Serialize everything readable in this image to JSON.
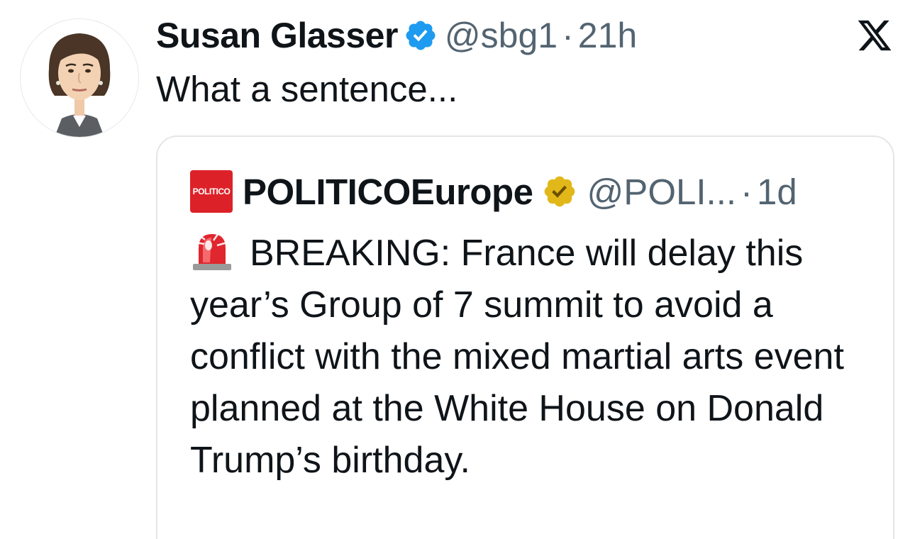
{
  "tweet": {
    "author_name": "Susan Glasser",
    "handle": "@sbg1",
    "separator": "·",
    "time": "21h",
    "text": "What a sentence...",
    "avatar_icon": "woman-cartoon-avatar",
    "verified_icon": "blue-check-badge",
    "platform_icon": "x-logo"
  },
  "quote": {
    "avatar_text": "POLITICO",
    "author_name": "POLITICOEurope",
    "handle": "@POLI...",
    "separator": "·",
    "time": "1d",
    "verified_icon": "gold-check-badge",
    "lead_icon": "police-siren-emoji",
    "text": "BREAKING: France will delay this year’s Group of 7 summit to avoid a conflict with the mixed martial arts event planned at the White House on Donald Trump’s birthday."
  },
  "colors": {
    "text": "#0f1419",
    "secondary": "#536471",
    "blue_badge": "#1d9bf0",
    "gold_badge": "#e2b719",
    "politico_red": "#dc2228",
    "card_border": "#e3e6e8"
  }
}
